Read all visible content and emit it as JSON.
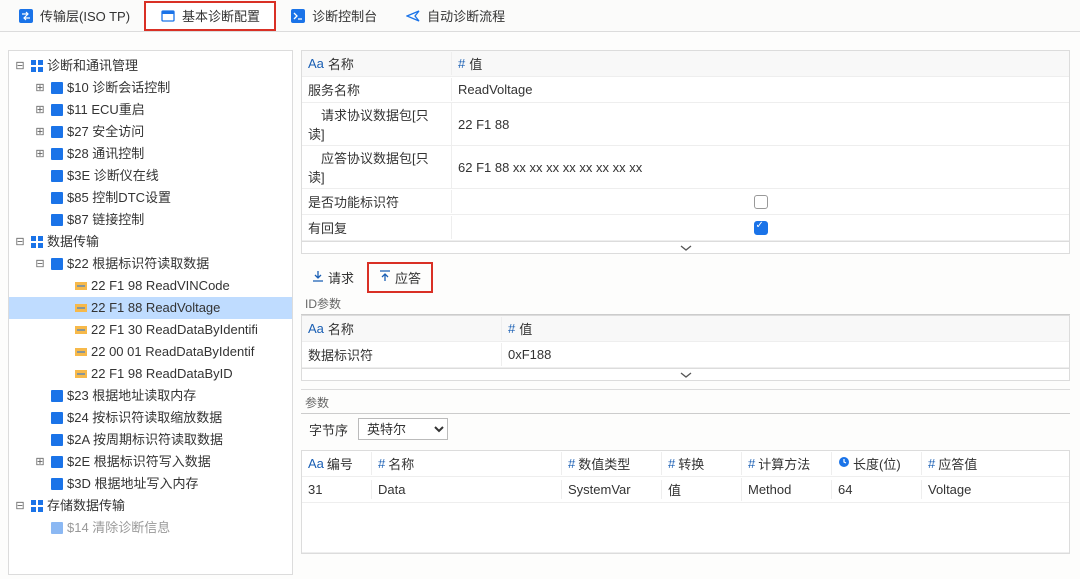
{
  "topTabs": {
    "t0": "传输层(ISO TP)",
    "t1": "基本诊断配置",
    "t2": "诊断控制台",
    "t3": "自动诊断流程"
  },
  "tree": {
    "n0": "诊断和通讯管理",
    "n0_0": "$10 诊断会话控制",
    "n0_1": "$11 ECU重启",
    "n0_2": "$27 安全访问",
    "n0_3": "$28 通讯控制",
    "n0_4": "$3E 诊断仪在线",
    "n0_5": "$85 控制DTC设置",
    "n0_6": "$87 链接控制",
    "n1": "数据传输",
    "n1_0": "$22 根据标识符读取数据",
    "n1_0_0": "22 F1 98 ReadVINCode",
    "n1_0_1": "22 F1 88 ReadVoltage",
    "n1_0_2": "22 F1 30 ReadDataByIdentifi",
    "n1_0_3": "22 00 01 ReadDataByIdentif",
    "n1_0_4": "22 F1 98 ReadDataByID",
    "n1_1": "$23 根据地址读取内存",
    "n1_2": "$24 按标识符读取缩放数据",
    "n1_3": "$2A 按周期标识符读取数据",
    "n1_4": "$2E 根据标识符写入数据",
    "n1_5": "$3D 根据地址写入内存",
    "n2": "存储数据传输",
    "n2_0": "$14 清除诊断信息"
  },
  "propsHeader": {
    "name": "名称",
    "value": "值"
  },
  "props": {
    "r0k": "服务名称",
    "r0v": "ReadVoltage",
    "r1k": "　请求协议数据包[只读]",
    "r1v": "22 F1 88",
    "r2k": "　应答协议数据包[只读]",
    "r2v": "62 F1 88 xx xx xx xx xx xx xx xx",
    "r3k": "是否功能标识符",
    "r4k": "有回复"
  },
  "subtabs": {
    "req": "请求",
    "resp": "应答"
  },
  "idParams": {
    "title": "ID参数",
    "nameH": "名称",
    "valueH": "值",
    "r0k": "数据标识符",
    "r0v": "0xF188"
  },
  "params": {
    "title": "参数",
    "byteOrderLabel": "字节序",
    "byteOrderValue": "英特尔"
  },
  "grid": {
    "h_idx": "编号",
    "h_name": "名称",
    "h_type": "数值类型",
    "h_conv": "转换",
    "h_method": "计算方法",
    "h_len": "长度(位)",
    "h_val": "应答值",
    "r_idx": "31",
    "r_name": "Data",
    "r_type": "SystemVar",
    "r_conv": "值",
    "r_method": "Method",
    "r_len": "64",
    "r_val": "Voltage"
  }
}
